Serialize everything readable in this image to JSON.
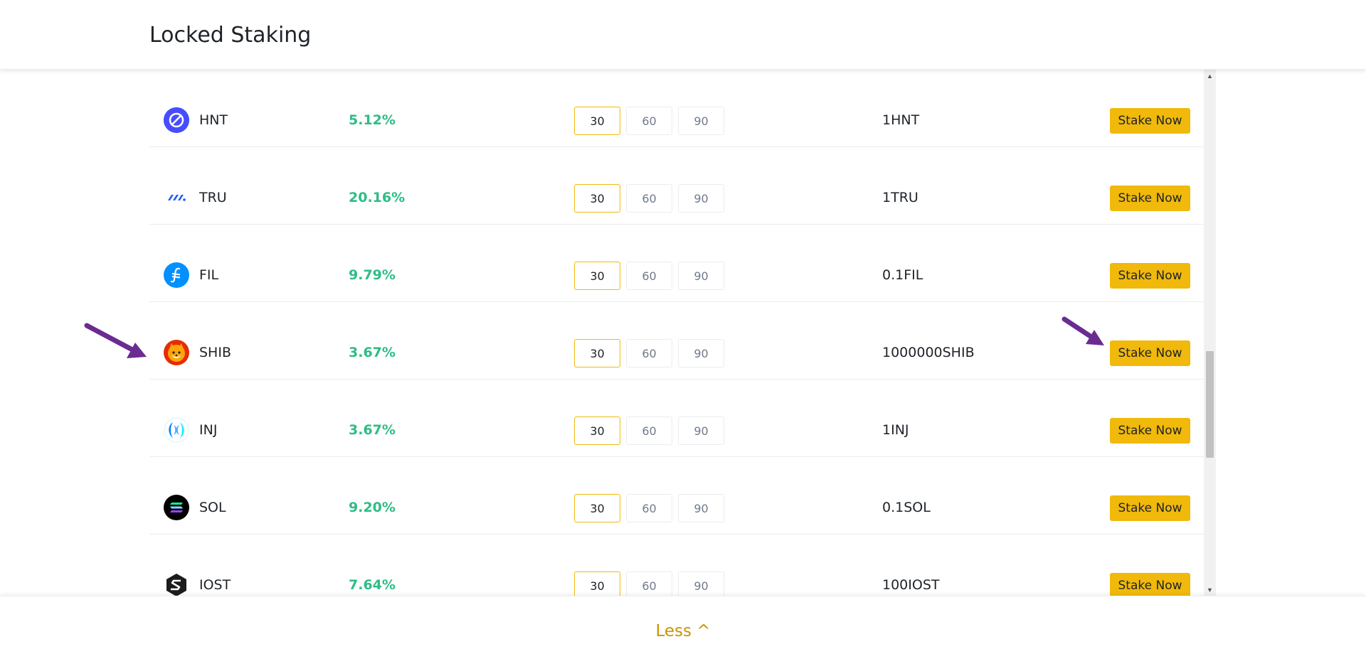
{
  "header": {
    "title": "Locked Staking"
  },
  "colors": {
    "accent": "#f0b90b",
    "apy_green": "#2ebd85",
    "link_gold": "#c99400",
    "annotation_arrow": "#6a2c91"
  },
  "rows": [
    {
      "icon": "hnt-icon",
      "coin": "HNT",
      "apy": "5.12%",
      "durations": [
        "30",
        "60",
        "90"
      ],
      "selected": "30",
      "min_amount": "1HNT",
      "action": "Stake Now"
    },
    {
      "icon": "tru-icon",
      "coin": "TRU",
      "apy": "20.16%",
      "durations": [
        "30",
        "60",
        "90"
      ],
      "selected": "30",
      "min_amount": "1TRU",
      "action": "Stake Now"
    },
    {
      "icon": "fil-icon",
      "coin": "FIL",
      "apy": "9.79%",
      "durations": [
        "30",
        "60",
        "90"
      ],
      "selected": "30",
      "min_amount": "0.1FIL",
      "action": "Stake Now"
    },
    {
      "icon": "shib-icon",
      "coin": "SHIB",
      "apy": "3.67%",
      "durations": [
        "30",
        "60",
        "90"
      ],
      "selected": "30",
      "min_amount": "1000000SHIB",
      "action": "Stake Now"
    },
    {
      "icon": "inj-icon",
      "coin": "INJ",
      "apy": "3.67%",
      "durations": [
        "30",
        "60",
        "90"
      ],
      "selected": "30",
      "min_amount": "1INJ",
      "action": "Stake Now"
    },
    {
      "icon": "sol-icon",
      "coin": "SOL",
      "apy": "9.20%",
      "durations": [
        "30",
        "60",
        "90"
      ],
      "selected": "30",
      "min_amount": "0.1SOL",
      "action": "Stake Now"
    },
    {
      "icon": "iost-icon",
      "coin": "IOST",
      "apy": "7.64%",
      "durations": [
        "30",
        "60",
        "90"
      ],
      "selected": "30",
      "min_amount": "100IOST",
      "action": "Stake Now"
    }
  ],
  "footer": {
    "less_label": "Less ^"
  }
}
